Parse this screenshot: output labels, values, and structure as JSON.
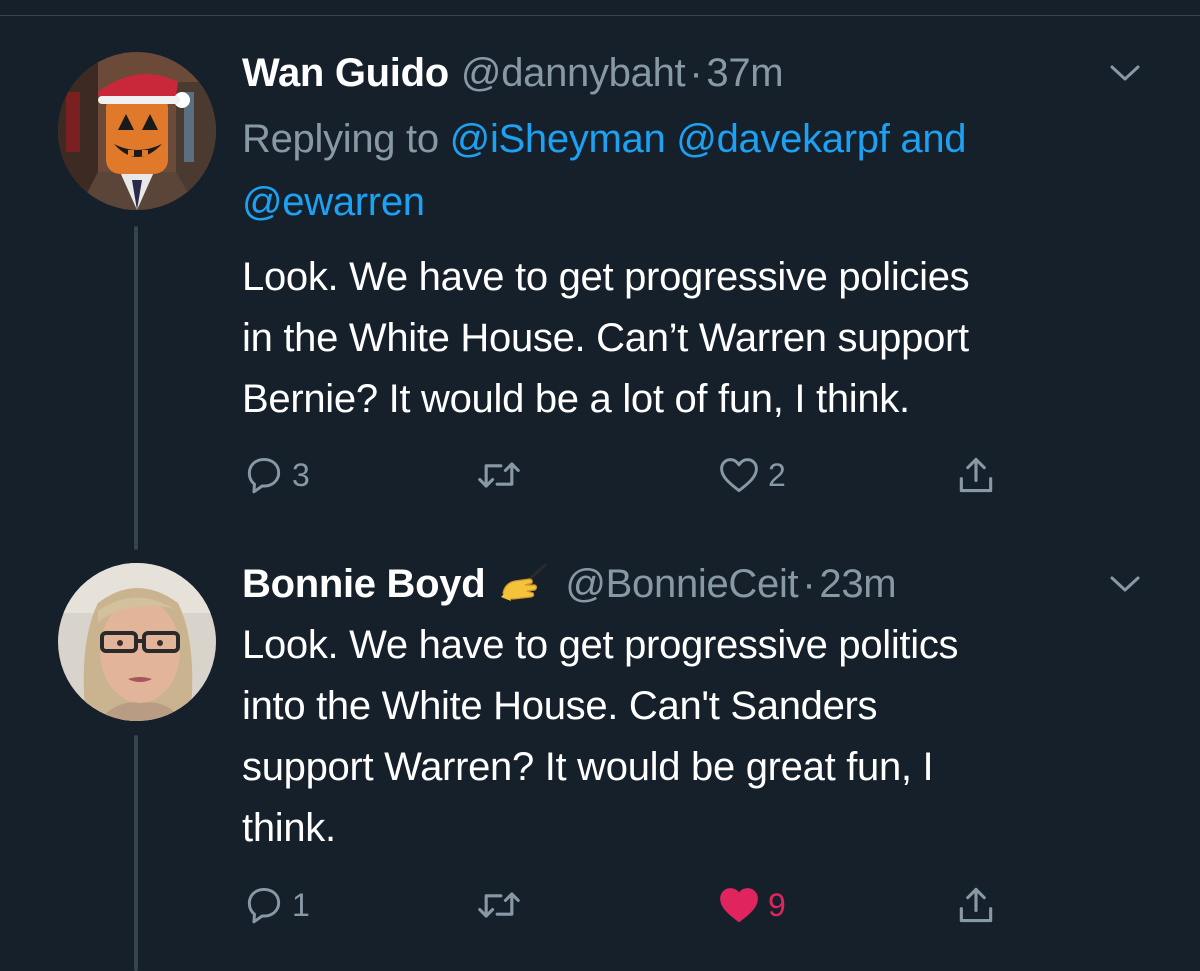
{
  "tweets": [
    {
      "name": "Wan Guido",
      "handle": "@dannybaht",
      "separator": "·",
      "time": "37m",
      "replying_prefix": "Replying to",
      "mentions": [
        "@iSheyman",
        "@davekarpf",
        "and",
        "@ewarren"
      ],
      "text_lines": [
        "Look. We have to get progressive policies",
        "in the White House. Can’t Warren support",
        "Bernie? It would be a lot of fun, I think."
      ],
      "reply_count": "3",
      "like_count": "2",
      "liked": false
    },
    {
      "name": "Bonnie Boyd",
      "badge_icon": "writing-hand-emoji",
      "handle": "@BonnieCeit",
      "separator": "·",
      "time": "23m",
      "text_lines": [
        "Look. We have to get progressive politics",
        "into the White House. Can't Sanders",
        "support Warren? It would be great fun, I",
        "think."
      ],
      "reply_count": "1",
      "like_count": "9",
      "liked": true
    }
  ],
  "colors": {
    "background": "#15202b",
    "text": "#ffffff",
    "secondary": "#8899a6",
    "link": "#1da1f2",
    "like": "#e0245e",
    "divider": "#38444d"
  }
}
